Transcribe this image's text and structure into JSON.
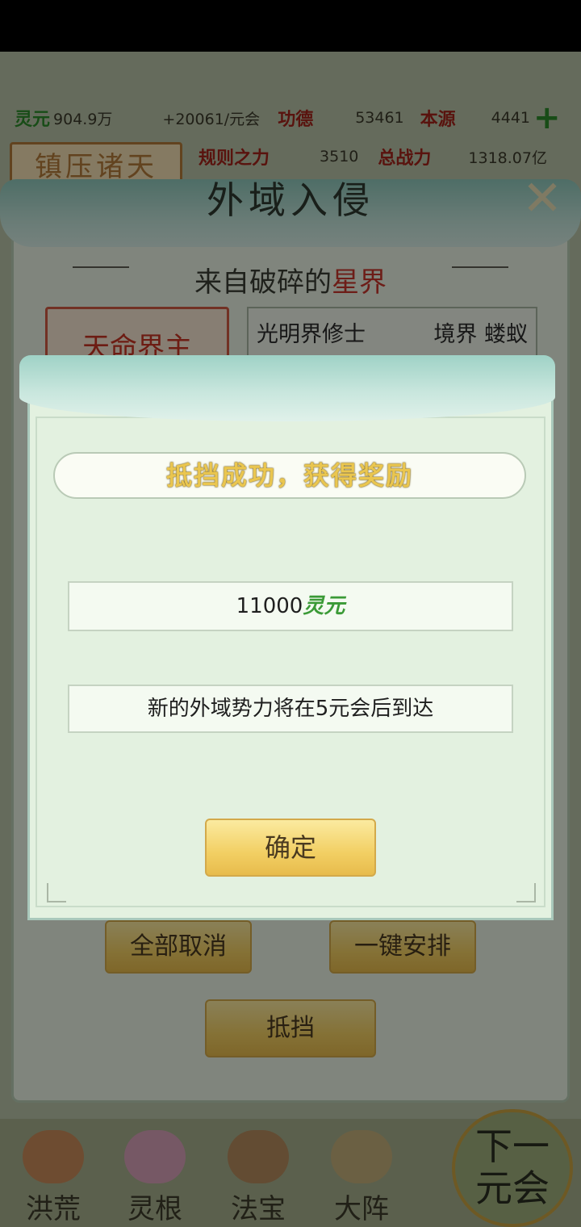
{
  "resources": {
    "lingyuan_label": "灵元",
    "lingyuan_value": "904.9万",
    "lingyuan_rate": "+20061/元会",
    "gongde_label": "功德",
    "gongde_value": "53461",
    "benyuan_label": "本源",
    "benyuan_value": "4441",
    "plus_symbol": "+",
    "guize_label": "规则之力",
    "guize_value": "3510",
    "zongzhanli_label": "总战力",
    "zongzhanli_value": "1318.07亿"
  },
  "zhenya_label": "镇压诸天",
  "panel": {
    "title": "外域入侵",
    "close": "✕",
    "subtitle_prefix": "来自破碎的",
    "subtitle_highlight": "星界",
    "tianming_label": "天命界主",
    "enemy_name": "光明界修士",
    "enemy_realm": "境界 蝼蚁",
    "cancel_all": "全部取消",
    "one_click": "一键安排",
    "block": "抵挡"
  },
  "modal": {
    "banner": "抵挡成功，获得奖励",
    "reward_amount": "11000",
    "reward_unit": "灵元",
    "next_arrival": "新的外域势力将在5元会后到达",
    "confirm": "确定"
  },
  "nav": {
    "items": [
      {
        "label": "洪荒"
      },
      {
        "label": "灵根"
      },
      {
        "label": "法宝"
      },
      {
        "label": "大阵"
      }
    ],
    "next_line1": "下一",
    "next_line2": "元会"
  },
  "colors": {
    "gold_button": "#f2cf63",
    "teal_header": "#9fd2c6",
    "reward_green": "#3a9a36"
  }
}
